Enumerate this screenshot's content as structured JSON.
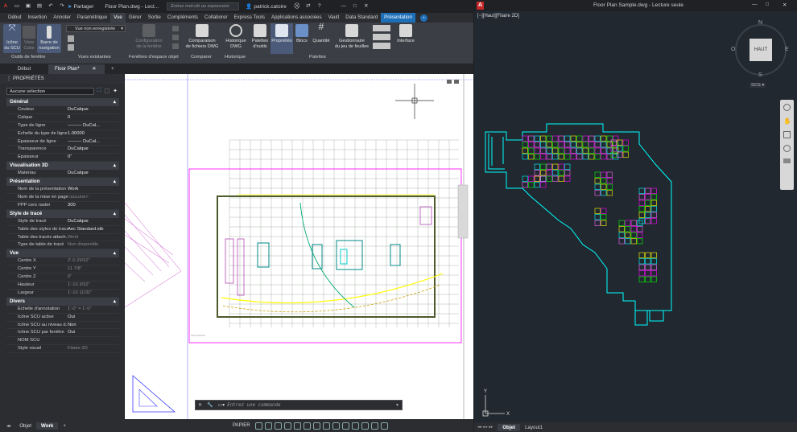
{
  "left_window": {
    "title": "Floor Plan.dwg - Lect...",
    "search_placeholder": "Entrez mot-clé ou expression",
    "user": "patrick.catoire",
    "share_label": "Partager",
    "menu_tabs": [
      "Début",
      "Insertion",
      "Annoter",
      "Paramétrique",
      "Vue",
      "Gérer",
      "Sortie",
      "Compléments",
      "Collaborer",
      "Express Tools",
      "Applications associées",
      "Vault",
      "Data Standard",
      "Présentation"
    ],
    "active_tab": "Vue",
    "ribbon": {
      "ucs_icon": "Icône\ndu SCU",
      "view_cube": "View\nCube",
      "nav_bar": "Barre de\nnavigation",
      "unsaved_view": "Vue non enregistrée",
      "viewport_config": "Configuration\nde la fenêtre",
      "compare_dwg": "Comparaison\nde fichiers DWG",
      "history_dwg": "Historique\nDWG",
      "tool_palettes": "Palettes\nd'outils",
      "properties": "Propriétés",
      "blocks": "Blocs",
      "quantity": "Quantité",
      "sheet_set": "Gestionnaire\ndu jeu de feuilles",
      "interface": "Interface",
      "groups": [
        "Outils de fenêtre",
        "Vues existantes",
        "Fenêtres d'espace objet",
        "Comparer",
        "Historique",
        "Palettes"
      ]
    },
    "doc_tabs": [
      "Début",
      "Floor Plan*"
    ],
    "properties_panel": {
      "title": "PROPRIÉTÉS",
      "selection": "Aucune sélection",
      "sections": [
        {
          "name": "Général",
          "rows": [
            [
              "Couleur",
              "DuCalque"
            ],
            [
              "Calque",
              "0"
            ],
            [
              "Type de ligne",
              "——— DuCal..."
            ],
            [
              "Echelle du type de ligne",
              "1.00000"
            ],
            [
              "Epaisseur de ligne",
              "——— DuCal..."
            ],
            [
              "Transparence",
              "DuCalque"
            ],
            [
              "Epaisseur",
              "0\""
            ]
          ]
        },
        {
          "name": "Visualisation 3D",
          "rows": [
            [
              "Matériau",
              "DuCalque"
            ]
          ]
        },
        {
          "name": "Présentation",
          "rows": [
            [
              "Nom de la présentation",
              "Work"
            ],
            [
              "Nom de la mise en page",
              "<aucune>"
            ],
            [
              "PPP cers raster",
              "300"
            ]
          ]
        },
        {
          "name": "Style de tracé",
          "rows": [
            [
              "Style de tracé",
              "DuCalque"
            ],
            [
              "Table des styles de tracé",
              "Aec Standard.stb"
            ],
            [
              "Table des tracés attach...",
              "Work"
            ],
            [
              "Type de table de tracé",
              "Non disponible"
            ]
          ]
        },
        {
          "name": "Vue",
          "rows": [
            [
              "Centre X",
              "2'-0 29/32\""
            ],
            [
              "Centre Y",
              "11 7/8\""
            ],
            [
              "Centre Z",
              "0\""
            ],
            [
              "Hauteur",
              "1'-10 3/32\""
            ],
            [
              "Largeur",
              "1'-10 11/32\""
            ]
          ]
        },
        {
          "name": "Divers",
          "rows": [
            [
              "Echelle d'annotation",
              "1'-0\" = 1'-0\""
            ],
            [
              "Icône SCU active",
              "Oui"
            ],
            [
              "Icône SCU au niveau d...",
              "Non"
            ],
            [
              "Icône SCU par fenêtre",
              "Oui"
            ],
            [
              "NOM SCU",
              ""
            ],
            [
              "Style visuel",
              "Filaire 2D"
            ]
          ]
        }
      ]
    },
    "command_placeholder": "Entrez une commande",
    "layout_tabs": [
      "Objet",
      "Work"
    ],
    "status_paper": "PAPIER"
  },
  "right_window": {
    "title": "Floor Plan Sample.dwg - Lecture seule",
    "viewport_label": "[−][Haut][Filaire 2D]",
    "viewcube": {
      "face": "HAUT",
      "n": "N",
      "s": "S",
      "e": "E",
      "o": "O",
      "scu": "SCG"
    },
    "layout_tabs": [
      "Objet",
      "Layout1"
    ]
  },
  "colors": {
    "accent": "#1d6fb8",
    "cyan": "#00ffff",
    "magenta": "#ff00ff",
    "yellow": "#ffff00",
    "green": "#00ff00"
  }
}
